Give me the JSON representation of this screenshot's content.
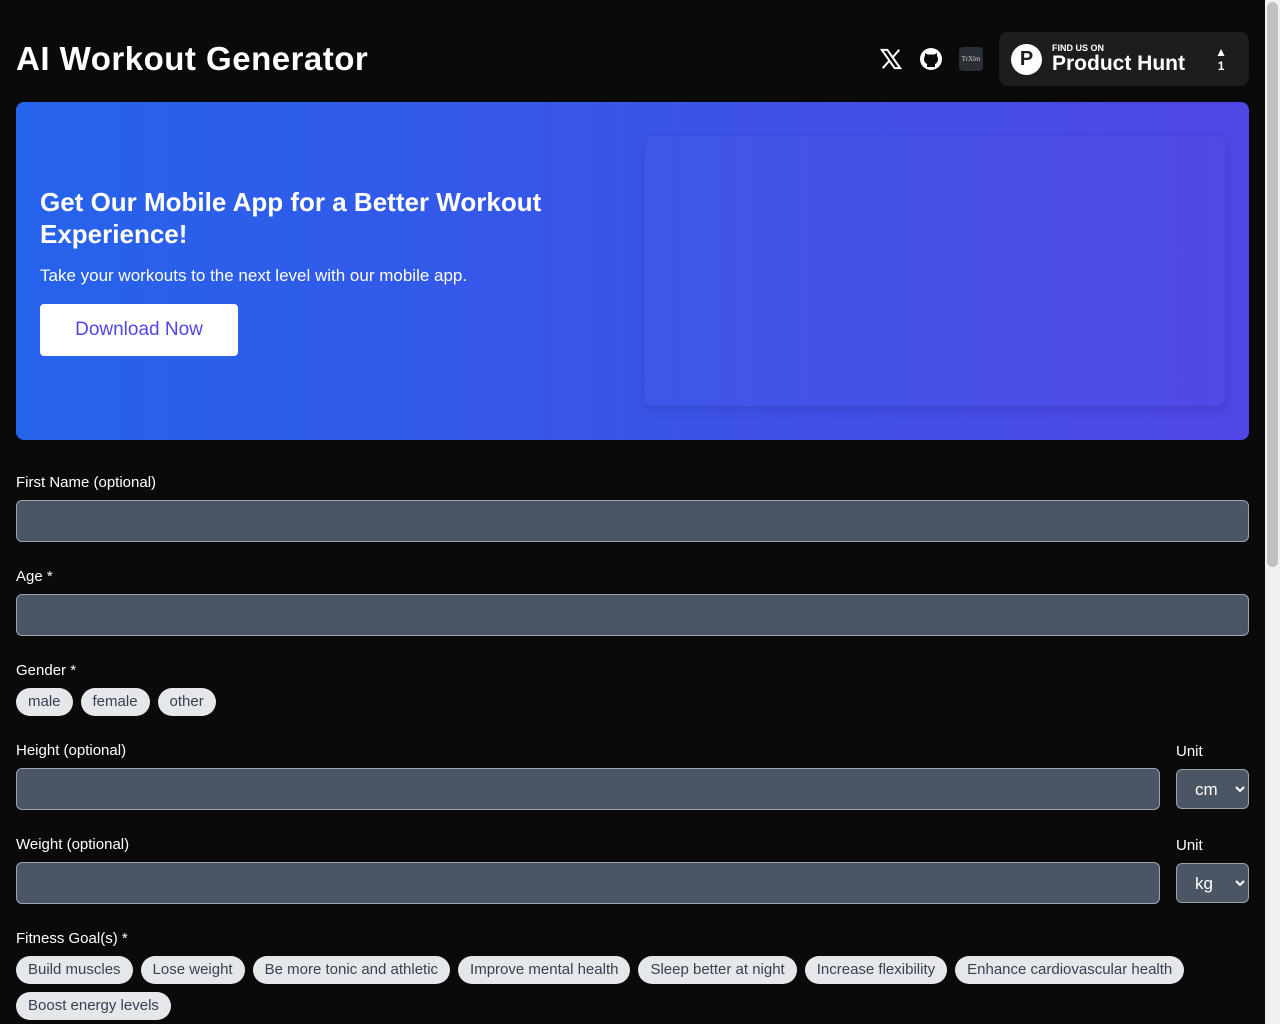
{
  "header": {
    "title": "AI Workout Generator",
    "icons": [
      "x-icon",
      "github-icon",
      "trxlm-icon"
    ],
    "trx_text": "TrXlm",
    "product_hunt": {
      "small": "FIND US ON",
      "big": "Product Hunt",
      "logo": "P",
      "arrow": "▲",
      "votes": "1"
    }
  },
  "banner": {
    "title": "Get Our Mobile App for a Better Workout Experience!",
    "subtitle": "Take your workouts to the next level with our mobile app.",
    "button": "Download Now"
  },
  "form": {
    "first_name": {
      "label": "First Name (optional)",
      "value": ""
    },
    "age": {
      "label": "Age *",
      "value": ""
    },
    "gender": {
      "label": "Gender *",
      "options": [
        "male",
        "female",
        "other"
      ]
    },
    "height": {
      "label": "Height (optional)",
      "unit_label": "Unit",
      "unit": "cm"
    },
    "weight": {
      "label": "Weight (optional)",
      "unit_label": "Unit",
      "unit": "kg"
    },
    "goals": {
      "label": "Fitness Goal(s) *",
      "options": [
        "Build muscles",
        "Lose weight",
        "Be more tonic and athletic",
        "Improve mental health",
        "Sleep better at night",
        "Increase flexibility",
        "Enhance cardiovascular health",
        "Boost energy levels"
      ]
    }
  }
}
